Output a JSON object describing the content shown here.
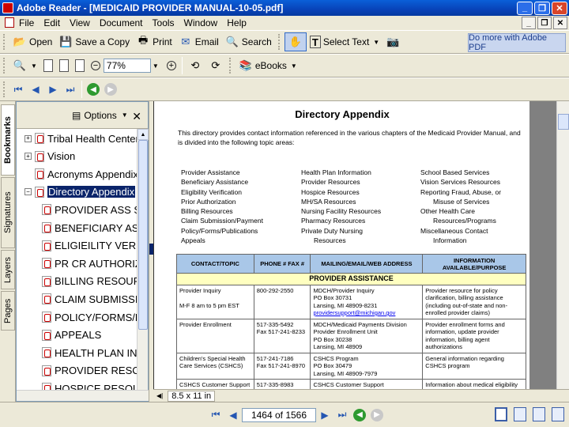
{
  "window": {
    "title": "Adobe Reader - [MEDICAID PROVIDER MANUAL-10-05.pdf]"
  },
  "menu": [
    "File",
    "Edit",
    "View",
    "Document",
    "Tools",
    "Window",
    "Help"
  ],
  "toolbar": {
    "open": "Open",
    "save_copy": "Save a Copy",
    "print": "Print",
    "email": "Email",
    "search": "Search",
    "select_text": "Select Text",
    "adobe_pdf": "Do more with Adobe PDF",
    "zoom": "77%",
    "ebooks": "eBooks"
  },
  "sidetabs": [
    "Bookmarks",
    "Signatures",
    "Layers",
    "Pages"
  ],
  "navpane": {
    "options": "Options"
  },
  "bookmarks": [
    {
      "label": "Tribal Health Centers",
      "level": 0,
      "exp": "+"
    },
    {
      "label": "Vision",
      "level": 0,
      "exp": "+"
    },
    {
      "label": "Acronyms Appendix",
      "level": 0,
      "exp": ""
    },
    {
      "label": "Directory Appendix",
      "level": 0,
      "exp": "−",
      "selected": true
    },
    {
      "label": "PROVIDER ASS S",
      "level": 1,
      "exp": ""
    },
    {
      "label": "BENEFICIARY AS",
      "level": 1,
      "exp": ""
    },
    {
      "label": "ELIGIEILITY VERI",
      "level": 1,
      "exp": ""
    },
    {
      "label": "PR CR AUTHORIZ",
      "level": 1,
      "exp": ""
    },
    {
      "label": "BILLING RESOUR",
      "level": 1,
      "exp": ""
    },
    {
      "label": "CLAIM SUBMISSI",
      "level": 1,
      "exp": ""
    },
    {
      "label": "POLICY/FORMS/F",
      "level": 1,
      "exp": ""
    },
    {
      "label": "APPEALS",
      "level": 1,
      "exp": ""
    },
    {
      "label": "HEALTH PLAN INI",
      "level": 1,
      "exp": ""
    },
    {
      "label": "PROVIDER RESC",
      "level": 1,
      "exp": ""
    },
    {
      "label": "HOSPICE RESOU",
      "level": 1,
      "exp": ""
    }
  ],
  "doc": {
    "title": "Directory Appendix",
    "intro": "This directory provides contact information referenced in the various chapters of the Medicaid Provider Manual, and is divided into the following topic areas:",
    "col1": [
      "Provider Assistance",
      "Beneficiary Assistance",
      "Eligibility Verification",
      "Prior Authorization",
      "Billing Resources",
      "Claim Submission/Payment",
      "Policy/Forms/Publications",
      "Appeals"
    ],
    "col2": [
      "Health Plan Information",
      "Provider Resources",
      "Hospice Resources",
      "MH/SA Resources",
      "Nursing Facility Resources",
      "Pharmacy Resources",
      "Private Duty Nursing",
      "Resources"
    ],
    "col3": [
      "School Based Services",
      "Vision Services Resources",
      "Reporting Fraud, Abuse, or",
      "Misuse of Services",
      "Other Health Care",
      "Resources/Programs",
      "Miscellaneous Contact",
      "Information"
    ],
    "table_headers": [
      "CONTACT/TOPIC",
      "PHONE # FAX #",
      "MAILING/EMAIL/WEB ADDRESS",
      "INFORMATION AVAILABLE/PURPOSE"
    ],
    "section": "PROVIDER ASSISTANCE",
    "rows": [
      {
        "topic": "Provider Inquiry\n\nM-F 8 am to 5 pm EST",
        "phone": "800-292-2550",
        "address": "MDCH/Provider Inquiry\nPO Box 30731\nLansing, MI  48909-8231",
        "email": "providersupport@michigan.gov",
        "info": "Provider resource for policy clarification, billing assistance (including out-of-state and non-enrolled provider claims)"
      },
      {
        "topic": "Provider Enrollment",
        "phone": "517-335-5492\nFax 517-241-8233",
        "address": "MDCH/Medicaid Payments Division\nProvider Enrollment Unit\nPO Box 30238\nLansing, MI  48909",
        "email": "",
        "info": "Provider enrollment forms and information, update provider information, billing agent authorizations"
      },
      {
        "topic": "Children's Special Health Care Services (CSHCS)",
        "phone": "517-241-7186\nFax 517-241-8970",
        "address": "CSHCS Program\nPO Box 30479\nLansing, MI  48909-7979",
        "email": "",
        "info": "General information regarding CSHCS program"
      },
      {
        "topic": "CSHCS Customer Support",
        "phone": "517-335-8983",
        "address": "CSHCS Customer Support",
        "email": "",
        "info": "Information about medical eligibility"
      }
    ],
    "page_size": "8.5 x 11 in"
  },
  "statusbar": {
    "page": "1464 of 1566"
  }
}
